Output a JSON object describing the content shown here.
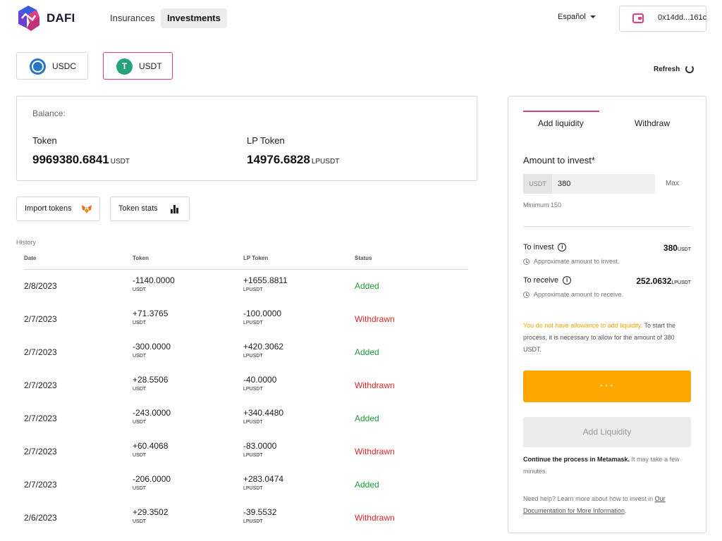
{
  "header": {
    "brand": "DAFI",
    "nav": [
      {
        "label": "Insurances"
      },
      {
        "label": "Investments"
      }
    ],
    "language": "Español",
    "wallet_address": "0x14dd...161c"
  },
  "tokens": [
    {
      "label": "USDC"
    },
    {
      "label": "USDT"
    }
  ],
  "refresh_label": "Refresh",
  "balance": {
    "title": "Balance:",
    "token_label": "Token",
    "token_value": "9969380.6841",
    "token_unit": "USDT",
    "lp_label": "LP Token",
    "lp_value": "14976.6828",
    "lp_unit": "LPUSDT"
  },
  "actions": {
    "import": "Import tokens",
    "stats": "Token stats"
  },
  "history": {
    "label": "History",
    "columns": [
      "Date",
      "Token",
      "LP Token",
      "Status"
    ],
    "rows": [
      {
        "date": "2/8/2023",
        "token": "-1140.0000",
        "token_unit": "USDT",
        "lp": "+1655.8811",
        "lp_unit": "LPUSDT",
        "status": "Added"
      },
      {
        "date": "2/7/2023",
        "token": "+71.3765",
        "token_unit": "USDT",
        "lp": "-100.0000",
        "lp_unit": "LPUSDT",
        "status": "Withdrawn"
      },
      {
        "date": "2/7/2023",
        "token": "-300.0000",
        "token_unit": "USDT",
        "lp": "+420.3062",
        "lp_unit": "LPUSDT",
        "status": "Added"
      },
      {
        "date": "2/7/2023",
        "token": "+28.5506",
        "token_unit": "USDT",
        "lp": "-40.0000",
        "lp_unit": "LPUSDT",
        "status": "Withdrawn"
      },
      {
        "date": "2/7/2023",
        "token": "-243.0000",
        "token_unit": "USDT",
        "lp": "+340.4480",
        "lp_unit": "LPUSDT",
        "status": "Added"
      },
      {
        "date": "2/7/2023",
        "token": "+60.4068",
        "token_unit": "USDT",
        "lp": "-83.0000",
        "lp_unit": "LPUSDT",
        "status": "Withdrawn"
      },
      {
        "date": "2/7/2023",
        "token": "-206.0000",
        "token_unit": "USDT",
        "lp": "+283.0474",
        "lp_unit": "LPUSDT",
        "status": "Added"
      },
      {
        "date": "2/6/2023",
        "token": "+29.3502",
        "token_unit": "USDT",
        "lp": "-39.5532",
        "lp_unit": "LPUSDT",
        "status": "Withdrawn"
      }
    ]
  },
  "panel": {
    "tabs": [
      {
        "label": "Add liquidity"
      },
      {
        "label": "Withdraw"
      }
    ],
    "amount_label": "Amount to invest*",
    "input_prefix": "USDT",
    "input_value": "380",
    "max_label": "Max",
    "minimum_note": "Minimum 150",
    "to_invest_label": "To invest",
    "to_invest_value": "380",
    "to_invest_unit": "USDT",
    "to_invest_note": "Approximate amount to invest.",
    "to_receive_label": "To receive",
    "to_receive_value": "252.0632",
    "to_receive_unit": "LPUSDT",
    "to_receive_note": "Approximate amount to receive.",
    "allowance_warning": "You do not have allowance to add liquidity.",
    "allowance_text": " To start the process, it is necessary to allow for the amount of 380 USDT.",
    "add_liquidity_button": "Add Liquidity",
    "continue_bold": "Continue the process in Metamask.",
    "continue_text": " It may take a few minutes.",
    "help_text": "Need help? Learn more about how to invest in ",
    "help_link": "Our Documentation for More Information",
    "help_end": "."
  },
  "colors": {
    "accent": "#e23d7e",
    "orange": "#ffa600",
    "added": "#1e9a36",
    "withdrawn": "#e02424"
  }
}
